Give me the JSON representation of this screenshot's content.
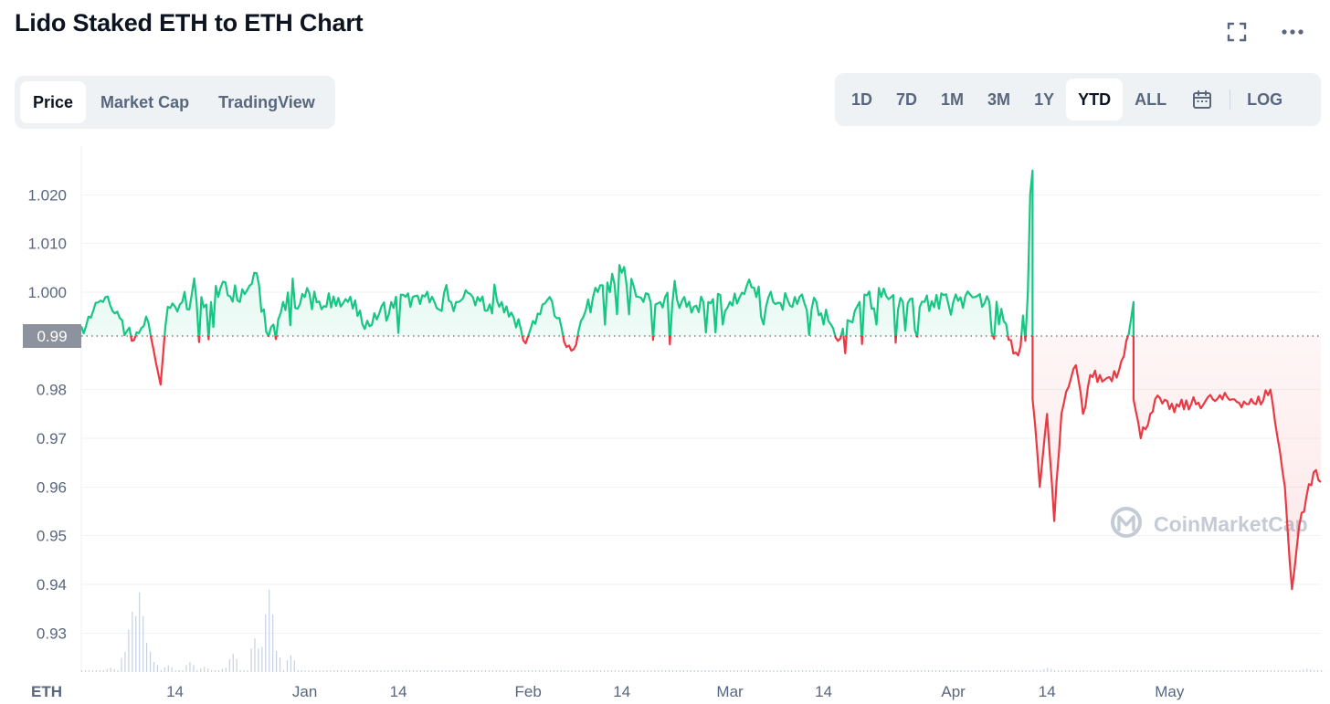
{
  "header": {
    "title": "Lido Staked ETH to ETH Chart",
    "icons": {
      "fullscreen": "fullscreen-icon",
      "more": "more-horizontal-icon"
    }
  },
  "tabs": [
    {
      "label": "Price",
      "active": true
    },
    {
      "label": "Market Cap",
      "active": false
    },
    {
      "label": "TradingView",
      "active": false
    }
  ],
  "ranges": [
    {
      "label": "1D",
      "active": false
    },
    {
      "label": "7D",
      "active": false
    },
    {
      "label": "1M",
      "active": false
    },
    {
      "label": "3M",
      "active": false
    },
    {
      "label": "1Y",
      "active": false
    },
    {
      "label": "YTD",
      "active": true
    },
    {
      "label": "ALL",
      "active": false
    }
  ],
  "calendar_icon": "calendar-icon",
  "log_label": "LOG",
  "chart_data": {
    "type": "line",
    "title": "",
    "ylim": [
      0.922,
      1.03
    ],
    "yticks": [
      "1.020",
      "1.010",
      "1.000",
      "0.99",
      "0.98",
      "0.97",
      "0.96",
      "0.95",
      "0.94",
      "0.93"
    ],
    "xlabel": "ETH",
    "x_tick_labels": [
      "14",
      "Jan",
      "14",
      "Feb",
      "14",
      "Mar",
      "14",
      "Apr",
      "14",
      "May"
    ],
    "baseline": {
      "label": "0.99",
      "value": 0.991
    },
    "colors": {
      "above": "#16c784",
      "below": "#ea3943",
      "grid": "#eff2f5",
      "axis_text": "#58667e"
    },
    "watermark": "CoinMarketCap",
    "x_range": [
      "2021-12-01",
      "2022-05-22"
    ],
    "series": [
      {
        "points": [
          [
            "2021-12-01",
            0.993
          ],
          [
            "2021-12-02",
            0.995
          ],
          [
            "2021-12-04",
            0.998
          ],
          [
            "2021-12-06",
            0.996
          ],
          [
            "2021-12-08",
            0.99
          ],
          [
            "2021-12-10",
            0.995
          ],
          [
            "2021-12-12",
            0.981
          ],
          [
            "2021-12-13",
            0.997
          ],
          [
            "2021-12-15",
            0.998
          ],
          [
            "2021-12-17",
            0.998
          ],
          [
            "2021-12-19",
            0.998
          ],
          [
            "2021-12-21",
            1.002
          ],
          [
            "2021-12-23",
            0.998
          ],
          [
            "2021-12-25",
            1.004
          ],
          [
            "2021-12-27",
            0.991
          ],
          [
            "2021-12-29",
            0.998
          ],
          [
            "2022-01-01",
            0.999
          ],
          [
            "2022-01-04",
            0.997
          ],
          [
            "2022-01-07",
            0.998
          ],
          [
            "2022-01-10",
            0.993
          ],
          [
            "2022-01-13",
            0.998
          ],
          [
            "2022-01-16",
            0.999
          ],
          [
            "2022-01-19",
            0.998
          ],
          [
            "2022-01-22",
            0.998
          ],
          [
            "2022-01-25",
            0.999
          ],
          [
            "2022-01-28",
            0.997
          ],
          [
            "2022-02-01",
            0.991
          ],
          [
            "2022-02-04",
            0.999
          ],
          [
            "2022-02-07",
            0.988
          ],
          [
            "2022-02-10",
            0.999
          ],
          [
            "2022-02-14",
            1.004
          ],
          [
            "2022-02-17",
            0.998
          ],
          [
            "2022-02-20",
            0.999
          ],
          [
            "2022-02-23",
            0.997
          ],
          [
            "2022-02-26",
            0.998
          ],
          [
            "2022-03-01",
            0.998
          ],
          [
            "2022-03-04",
            1.001
          ],
          [
            "2022-03-07",
            0.998
          ],
          [
            "2022-03-10",
            0.999
          ],
          [
            "2022-03-13",
            0.998
          ],
          [
            "2022-03-16",
            0.99
          ],
          [
            "2022-03-19",
            0.998
          ],
          [
            "2022-03-22",
            0.999
          ],
          [
            "2022-03-25",
            0.998
          ],
          [
            "2022-03-28",
            0.998
          ],
          [
            "2022-04-01",
            0.998
          ],
          [
            "2022-04-04",
            0.999
          ],
          [
            "2022-04-06",
            0.998
          ],
          [
            "2022-04-08",
            0.994
          ],
          [
            "2022-04-10",
            0.987
          ],
          [
            "2022-04-11",
            0.99
          ],
          [
            "2022-04-12",
            1.025
          ],
          [
            "2022-04-12",
            0.978
          ],
          [
            "2022-04-13",
            0.96
          ],
          [
            "2022-04-14",
            0.975
          ],
          [
            "2022-04-15",
            0.953
          ],
          [
            "2022-04-16",
            0.975
          ],
          [
            "2022-04-18",
            0.985
          ],
          [
            "2022-04-19",
            0.975
          ],
          [
            "2022-04-20",
            0.983
          ],
          [
            "2022-04-22",
            0.982
          ],
          [
            "2022-04-24",
            0.984
          ],
          [
            "2022-04-25",
            0.99
          ],
          [
            "2022-04-26",
            0.998
          ],
          [
            "2022-04-26",
            0.978
          ],
          [
            "2022-04-27",
            0.97
          ],
          [
            "2022-04-29",
            0.978
          ],
          [
            "2022-05-01",
            0.976
          ],
          [
            "2022-05-04",
            0.977
          ],
          [
            "2022-05-07",
            0.978
          ],
          [
            "2022-05-10",
            0.978
          ],
          [
            "2022-05-13",
            0.977
          ],
          [
            "2022-05-15",
            0.98
          ],
          [
            "2022-05-16",
            0.97
          ],
          [
            "2022-05-17",
            0.96
          ],
          [
            "2022-05-18",
            0.939
          ],
          [
            "2022-05-19",
            0.952
          ],
          [
            "2022-05-20",
            0.958
          ],
          [
            "2022-05-21",
            0.963
          ],
          [
            "2022-05-22",
            0.961
          ]
        ]
      }
    ],
    "volume": [
      [
        "2021-12-01",
        0.02
      ],
      [
        "2021-12-05",
        0.05
      ],
      [
        "2021-12-07",
        0.24
      ],
      [
        "2021-12-08",
        0.72
      ],
      [
        "2021-12-09",
        0.95
      ],
      [
        "2021-12-10",
        0.35
      ],
      [
        "2021-12-11",
        0.12
      ],
      [
        "2021-12-13",
        0.08
      ],
      [
        "2021-12-16",
        0.12
      ],
      [
        "2021-12-18",
        0.06
      ],
      [
        "2021-12-21",
        0.05
      ],
      [
        "2021-12-22",
        0.22
      ],
      [
        "2021-12-25",
        0.4
      ],
      [
        "2021-12-26",
        0.3
      ],
      [
        "2021-12-27",
        0.98
      ],
      [
        "2021-12-28",
        0.25
      ],
      [
        "2021-12-30",
        0.2
      ],
      [
        "2022-01-03",
        0.02
      ],
      [
        "2022-04-12",
        0.03
      ],
      [
        "2022-04-14",
        0.05
      ],
      [
        "2022-05-20",
        0.04
      ]
    ]
  }
}
